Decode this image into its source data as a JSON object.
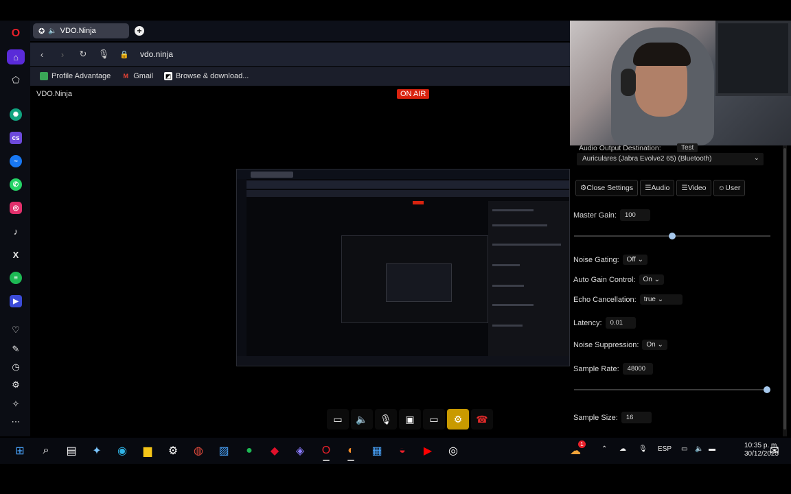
{
  "browser": {
    "tab_title": "VDO.Ninja",
    "new_tab_symbol": "+",
    "url": "vdo.ninja",
    "bookmarks": [
      "Profile Advantage",
      "Gmail",
      "Browse & download..."
    ],
    "page_title": "VDO.Ninja",
    "on_air_label": "ON AIR"
  },
  "sidebar_icons": [
    "opera-logo",
    "home",
    "pinboard",
    "chatgpt",
    "cs",
    "messenger",
    "whatsapp",
    "instagram",
    "tiktok",
    "x",
    "spotify",
    "player",
    "heart",
    "edit",
    "history",
    "settings",
    "tips",
    "more"
  ],
  "settings_panel": {
    "audio_output_label": "Audio Output Destination:",
    "test_label": "Test",
    "audio_output_device": "Auriculares (Jabra Evolve2 65) (Bluetooth)",
    "buttons": [
      "Close Settings",
      "Audio",
      "Video",
      "User"
    ],
    "master_gain": {
      "label": "Master Gain:",
      "value": "100",
      "level": 0.5
    },
    "noise_gating": {
      "label": "Noise Gating:",
      "value": "Off"
    },
    "auto_gain_control": {
      "label": "Auto Gain Control:",
      "value": "On"
    },
    "echo_cancellation": {
      "label": "Echo Cancellation:",
      "value": "true"
    },
    "latency": {
      "label": "Latency:",
      "value": "0.01"
    },
    "noise_suppression": {
      "label": "Noise Suppression:",
      "value": "On"
    },
    "sample_rate": {
      "label": "Sample Rate:",
      "value": "48000",
      "level": 1.0
    },
    "sample_size": {
      "label": "Sample Size:",
      "value": "16"
    }
  },
  "control_bar": [
    "chat",
    "speaker",
    "microphone",
    "camera",
    "screen-share",
    "settings",
    "hang-up"
  ],
  "taskbar": {
    "apps": [
      "start",
      "search",
      "file-manager",
      "copilot",
      "edge",
      "explorer",
      "steam",
      "chrome",
      "photos",
      "spotify",
      "app-red",
      "app-blue",
      "opera",
      "app-orange",
      "store",
      "app-red2",
      "youtube",
      "app-circle"
    ],
    "language": "ESP",
    "time": "10:35 p. m.",
    "date": "30/12/2025",
    "notification_count": "1"
  }
}
